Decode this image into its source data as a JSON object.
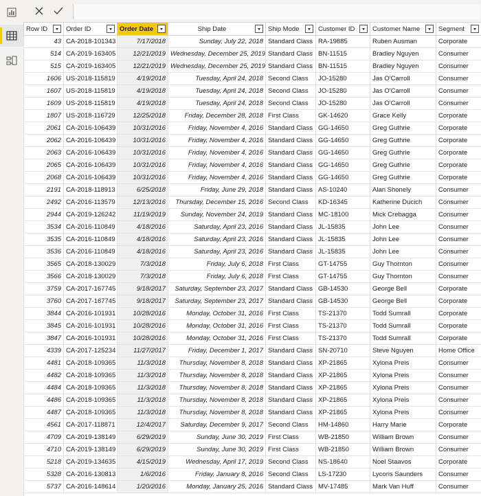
{
  "nav": {
    "report_view": "report-view-icon",
    "data_view": "table-icon",
    "model_view": "model-view-icon"
  },
  "toolbar": {
    "cancel": "close-icon",
    "commit": "check-icon"
  },
  "colors": {
    "selected_column": "#f2c811"
  },
  "table": {
    "headers": [
      "Row ID",
      "Order ID",
      "Order Date",
      "Ship Date",
      "Ship Mode",
      "Customer ID",
      "Customer Name",
      "Segment"
    ],
    "selected_column": "Order Date",
    "rows": [
      [
        "43",
        "CA-2018-101343",
        "7/17/2018",
        "Sunday, July 22, 2018",
        "Standard Class",
        "RA-19885",
        "Ruben Ausman",
        "Corporate"
      ],
      [
        "514",
        "CA-2019-163405",
        "12/21/2019",
        "Wednesday, December 25, 2019",
        "Standard Class",
        "BN-11515",
        "Bradley Nguyen",
        "Consumer"
      ],
      [
        "515",
        "CA-2019-163405",
        "12/21/2019",
        "Wednesday, December 25, 2019",
        "Standard Class",
        "BN-11515",
        "Bradley Nguyen",
        "Consumer"
      ],
      [
        "1606",
        "US-2018-115819",
        "4/19/2018",
        "Tuesday, April 24, 2018",
        "Second Class",
        "JO-15280",
        "Jas O'Carroll",
        "Consumer"
      ],
      [
        "1607",
        "US-2018-115819",
        "4/19/2018",
        "Tuesday, April 24, 2018",
        "Second Class",
        "JO-15280",
        "Jas O'Carroll",
        "Consumer"
      ],
      [
        "1609",
        "US-2018-115819",
        "4/19/2018",
        "Tuesday, April 24, 2018",
        "Second Class",
        "JO-15280",
        "Jas O'Carroll",
        "Consumer"
      ],
      [
        "1807",
        "US-2018-116729",
        "12/25/2018",
        "Friday, December 28, 2018",
        "First Class",
        "GK-14620",
        "Grace Kelly",
        "Corporate"
      ],
      [
        "2061",
        "CA-2016-106439",
        "10/31/2016",
        "Friday, November 4, 2016",
        "Standard Class",
        "GG-14650",
        "Greg Guthrie",
        "Corporate"
      ],
      [
        "2062",
        "CA-2016-106439",
        "10/31/2016",
        "Friday, November 4, 2016",
        "Standard Class",
        "GG-14650",
        "Greg Guthrie",
        "Corporate"
      ],
      [
        "2063",
        "CA-2016-106439",
        "10/31/2016",
        "Friday, November 4, 2016",
        "Standard Class",
        "GG-14650",
        "Greg Guthrie",
        "Corporate"
      ],
      [
        "2065",
        "CA-2016-106439",
        "10/31/2016",
        "Friday, November 4, 2016",
        "Standard Class",
        "GG-14650",
        "Greg Guthrie",
        "Corporate"
      ],
      [
        "2068",
        "CA-2016-106439",
        "10/31/2016",
        "Friday, November 4, 2016",
        "Standard Class",
        "GG-14650",
        "Greg Guthrie",
        "Corporate"
      ],
      [
        "2191",
        "CA-2018-118913",
        "6/25/2018",
        "Friday, June 29, 2018",
        "Standard Class",
        "AS-10240",
        "Alan Shonely",
        "Consumer"
      ],
      [
        "2492",
        "CA-2016-113579",
        "12/13/2016",
        "Thursday, December 15, 2016",
        "Second Class",
        "KD-16345",
        "Katherine Ducich",
        "Consumer"
      ],
      [
        "2944",
        "CA-2019-126242",
        "11/19/2019",
        "Sunday, November 24, 2019",
        "Standard Class",
        "MC-18100",
        "Mick Crebagga",
        "Consumer"
      ],
      [
        "3534",
        "CA-2016-110849",
        "4/18/2016",
        "Saturday, April 23, 2016",
        "Standard Class",
        "JL-15835",
        "John Lee",
        "Consumer"
      ],
      [
        "3535",
        "CA-2016-110849",
        "4/18/2016",
        "Saturday, April 23, 2016",
        "Standard Class",
        "JL-15835",
        "John Lee",
        "Consumer"
      ],
      [
        "3536",
        "CA-2016-110849",
        "4/18/2016",
        "Saturday, April 23, 2016",
        "Standard Class",
        "JL-15835",
        "John Lee",
        "Consumer"
      ],
      [
        "3565",
        "CA-2018-130029",
        "7/3/2018",
        "Friday, July 6, 2018",
        "First Class",
        "GT-14755",
        "Guy Thornton",
        "Consumer"
      ],
      [
        "3566",
        "CA-2018-130029",
        "7/3/2018",
        "Friday, July 6, 2018",
        "First Class",
        "GT-14755",
        "Guy Thornton",
        "Consumer"
      ],
      [
        "3759",
        "CA-2017-167745",
        "9/18/2017",
        "Saturday, September 23, 2017",
        "Standard Class",
        "GB-14530",
        "George Bell",
        "Corporate"
      ],
      [
        "3760",
        "CA-2017-167745",
        "9/18/2017",
        "Saturday, September 23, 2017",
        "Standard Class",
        "GB-14530",
        "George Bell",
        "Corporate"
      ],
      [
        "3844",
        "CA-2016-101931",
        "10/28/2016",
        "Monday, October 31, 2016",
        "First Class",
        "TS-21370",
        "Todd Sumrall",
        "Corporate"
      ],
      [
        "3845",
        "CA-2016-101931",
        "10/28/2016",
        "Monday, October 31, 2016",
        "First Class",
        "TS-21370",
        "Todd Sumrall",
        "Corporate"
      ],
      [
        "3847",
        "CA-2016-101931",
        "10/28/2016",
        "Monday, October 31, 2016",
        "First Class",
        "TS-21370",
        "Todd Sumrall",
        "Corporate"
      ],
      [
        "4339",
        "CA-2017-125234",
        "11/27/2017",
        "Friday, December 1, 2017",
        "Standard Class",
        "SN-20710",
        "Steve Nguyen",
        "Home Office"
      ],
      [
        "4481",
        "CA-2018-109365",
        "11/3/2018",
        "Thursday, November 8, 2018",
        "Standard Class",
        "XP-21865",
        "Xylona Preis",
        "Consumer"
      ],
      [
        "4482",
        "CA-2018-109365",
        "11/3/2018",
        "Thursday, November 8, 2018",
        "Standard Class",
        "XP-21865",
        "Xylona Preis",
        "Consumer"
      ],
      [
        "4484",
        "CA-2018-109365",
        "11/3/2018",
        "Thursday, November 8, 2018",
        "Standard Class",
        "XP-21865",
        "Xylona Preis",
        "Consumer"
      ],
      [
        "4486",
        "CA-2018-109365",
        "11/3/2018",
        "Thursday, November 8, 2018",
        "Standard Class",
        "XP-21865",
        "Xylona Preis",
        "Consumer"
      ],
      [
        "4487",
        "CA-2018-109365",
        "11/3/2018",
        "Thursday, November 8, 2018",
        "Standard Class",
        "XP-21865",
        "Xylona Preis",
        "Consumer"
      ],
      [
        "4561",
        "CA-2017-118871",
        "12/4/2017",
        "Saturday, December 9, 2017",
        "Second Class",
        "HM-14860",
        "Harry Marie",
        "Corporate"
      ],
      [
        "4709",
        "CA-2019-138149",
        "6/29/2019",
        "Sunday, June 30, 2019",
        "First Class",
        "WB-21850",
        "William Brown",
        "Consumer"
      ],
      [
        "4710",
        "CA-2019-138149",
        "6/29/2019",
        "Sunday, June 30, 2019",
        "First Class",
        "WB-21850",
        "William Brown",
        "Consumer"
      ],
      [
        "5218",
        "CA-2019-134635",
        "4/15/2019",
        "Wednesday, April 17, 2019",
        "Second Class",
        "NS-18640",
        "Noel Staavos",
        "Corporate"
      ],
      [
        "5328",
        "CA-2016-130813",
        "1/6/2016",
        "Friday, January 8, 2016",
        "Second Class",
        "LS-17230",
        "Lycoris Saunders",
        "Consumer"
      ],
      [
        "5737",
        "CA-2016-148614",
        "1/20/2016",
        "Monday, January 25, 2016",
        "Standard Class",
        "MV-17485",
        "Mark Van Huff",
        "Consumer"
      ]
    ]
  }
}
